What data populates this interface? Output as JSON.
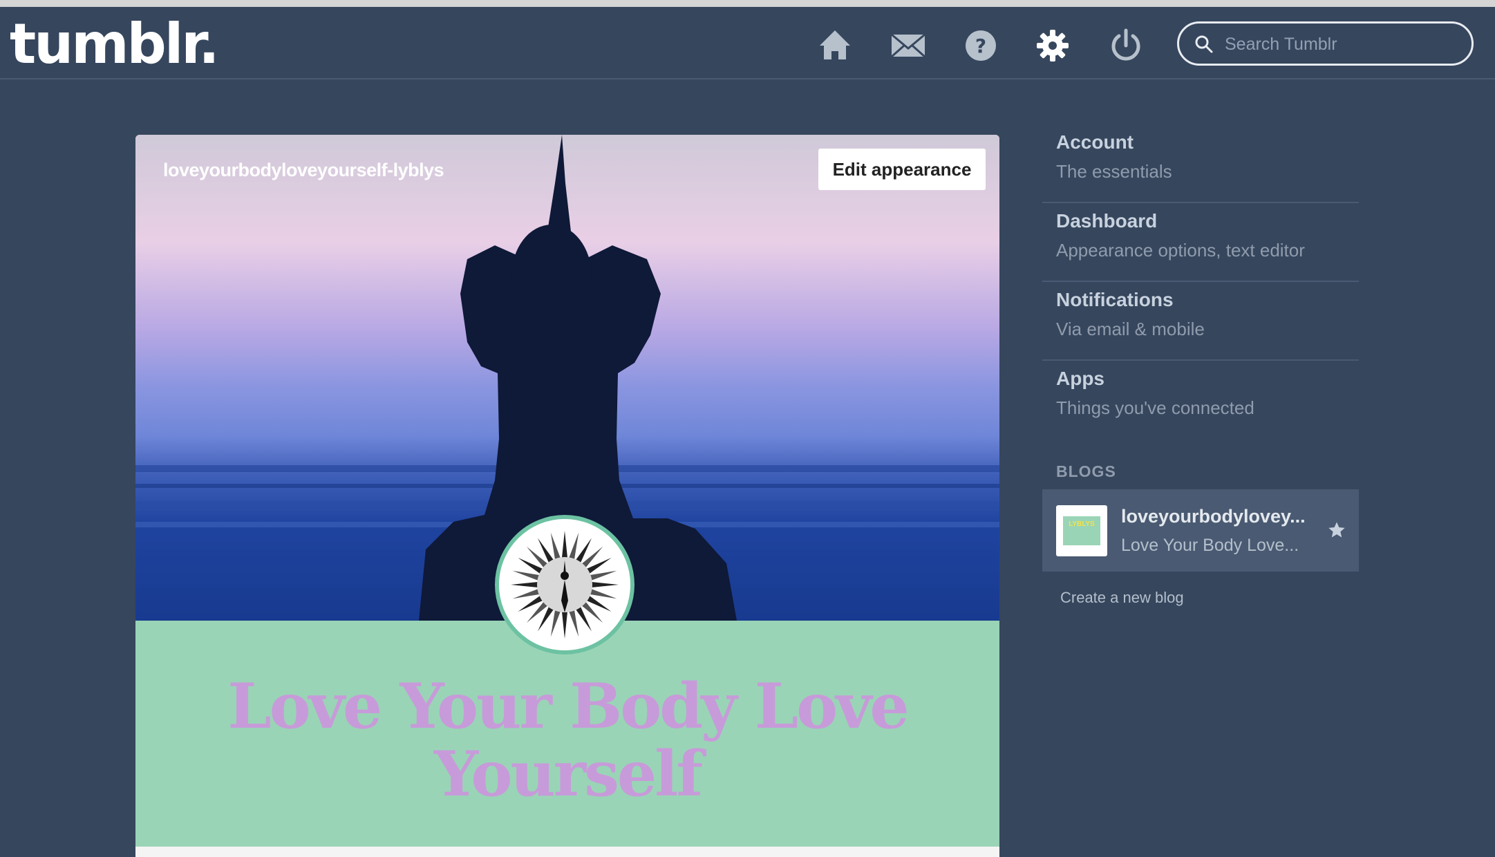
{
  "header": {
    "logo": "tumblr.",
    "search": {
      "placeholder": "Search Tumblr",
      "value": ""
    },
    "icons": [
      "home-icon",
      "mail-icon",
      "help-icon",
      "settings-icon",
      "power-icon"
    ]
  },
  "blog_card": {
    "url": "loveyourbodyloveyourself-lyblys",
    "edit_button": "Edit appearance",
    "title": "Love Your Body Love Yourself",
    "title_color": "#c79bd9",
    "title_background": "#9ad4b6"
  },
  "sidebar": {
    "menu": [
      {
        "title": "Account",
        "subtitle": "The essentials"
      },
      {
        "title": "Dashboard",
        "subtitle": "Appearance options, text editor"
      },
      {
        "title": "Notifications",
        "subtitle": "Via email & mobile"
      },
      {
        "title": "Apps",
        "subtitle": "Things you've connected"
      }
    ],
    "blogs_label": "BLOGS",
    "blogs": [
      {
        "name": "loveyourbodylovey...",
        "subtitle": "Love Your Body Love...",
        "thumb_text": "LYBLYS"
      }
    ],
    "create_link": "Create a new blog"
  },
  "colors": {
    "background": "#36465d",
    "accent_green": "#9ad4b6",
    "accent_purple": "#c79bd9"
  }
}
